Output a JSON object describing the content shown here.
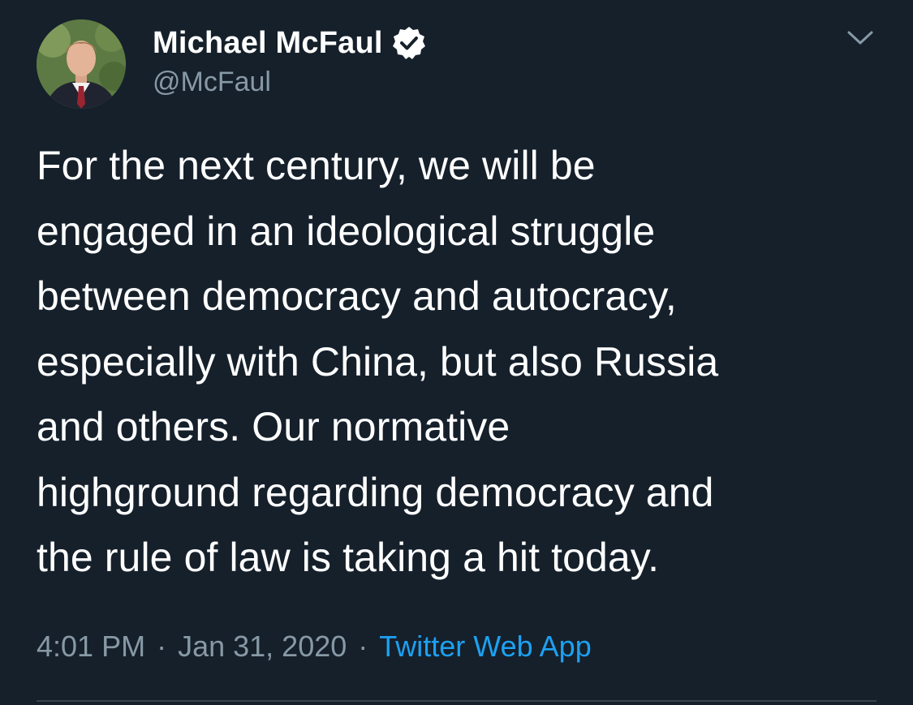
{
  "author": {
    "name": "Michael McFaul",
    "handle": "@McFaul",
    "verified": true,
    "avatar_icon": "profile-photo"
  },
  "tweet": {
    "text": "For the next century, we will be\nengaged in an ideological struggle\nbetween democracy and autocracy,\nespecially with China, but also Russia\nand others.  Our normative\nhighground regarding democracy and\nthe rule of law is taking a hit today."
  },
  "meta": {
    "time": "4:01 PM",
    "separator": "·",
    "date": "Jan 31, 2020",
    "source": "Twitter Web App"
  },
  "icons": {
    "verified": "verified-badge-icon",
    "menu": "chevron-down-icon"
  },
  "colors": {
    "background": "#15202b",
    "text_primary": "#ffffff",
    "text_secondary": "#8899a6",
    "link": "#1da1f2",
    "divider": "#38444d"
  }
}
